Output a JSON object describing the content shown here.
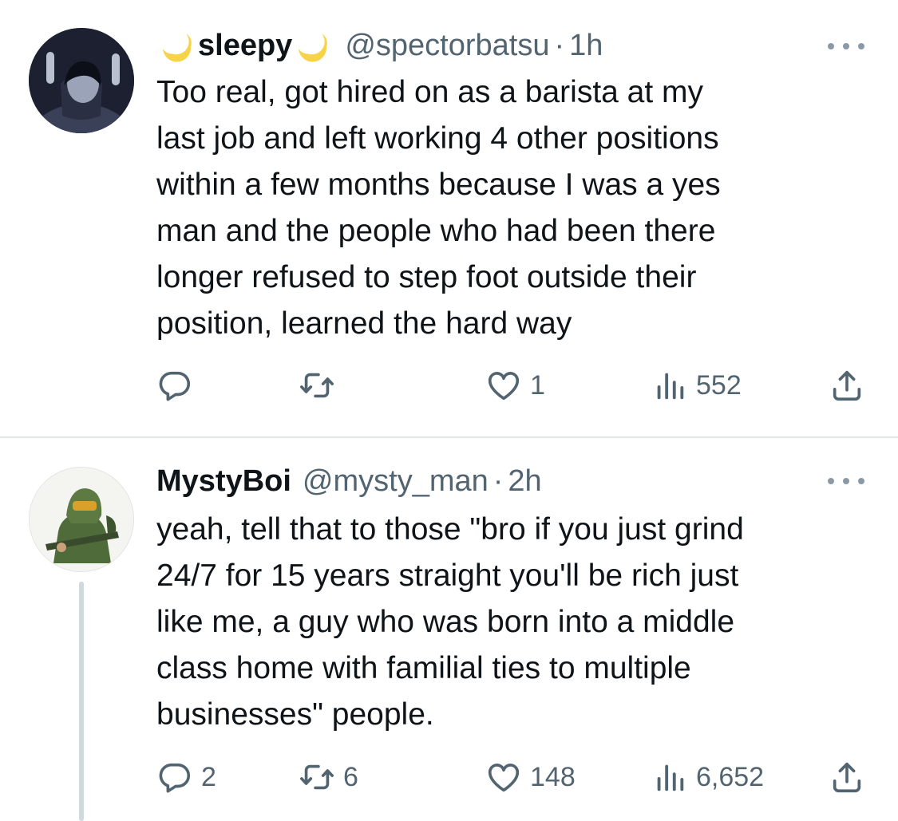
{
  "tweets": [
    {
      "display_name": "sleepy",
      "handle": "@spectorbatsu",
      "separator": "·",
      "time": "1h",
      "text": "Too real, got hired on as a barista at my\nlast job and left working 4 other positions\nwithin a few months because I was a yes\nman and the people who had been there\nlonger refused to step foot outside their\nposition, learned the hard way",
      "replies": "",
      "retweets": "",
      "likes": "1",
      "views": "552"
    },
    {
      "display_name": "MystyBoi",
      "handle": "@mysty_man",
      "separator": "·",
      "time": "2h",
      "text": "yeah, tell that to those \"bro if you just grind\n24/7 for 15 years straight you'll be rich just\nlike me, a guy who was born into a middle\nclass home with familial ties to multiple\nbusinesses\" people.",
      "replies": "2",
      "retweets": "6",
      "likes": "148",
      "views": "6,652"
    }
  ],
  "colors": {
    "text_primary": "#0f1419",
    "text_secondary": "#536471",
    "divider": "#e1e6ea",
    "moon": "#f5c518"
  },
  "icons": [
    "reply-icon",
    "retweet-icon",
    "like-icon",
    "views-icon",
    "share-icon",
    "more-icon",
    "crescent-moon-icon"
  ]
}
